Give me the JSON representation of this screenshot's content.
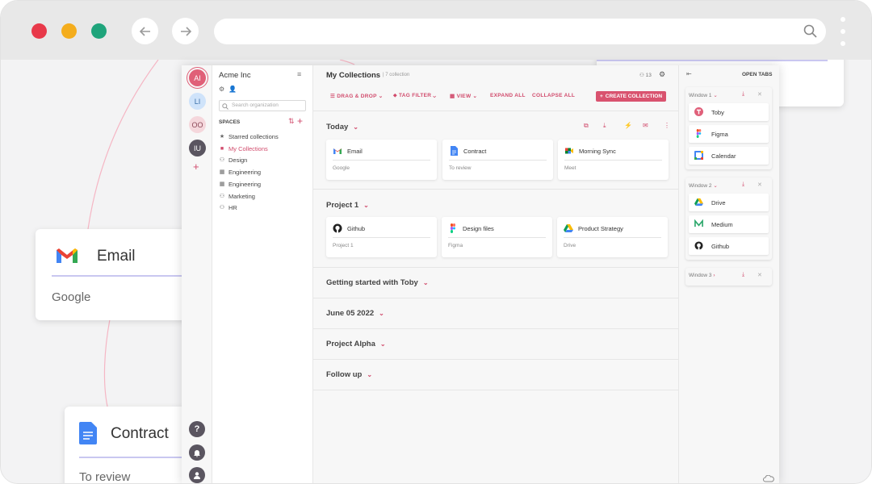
{
  "workspace": {
    "name": "Acme Inc",
    "search_placeholder": "Search organization",
    "spaces_label": "SPACES"
  },
  "avatars": [
    "AI",
    "LI",
    "OO",
    "IU"
  ],
  "sidebar": {
    "items": [
      {
        "label": "Starred collections",
        "icon": "star-icon"
      },
      {
        "label": "My Collections",
        "icon": "lock-icon"
      },
      {
        "label": "Design",
        "icon": "people-icon"
      },
      {
        "label": "Engineering",
        "icon": "building-icon"
      },
      {
        "label": "Engineering",
        "icon": "building-icon"
      },
      {
        "label": "Marketing",
        "icon": "people-icon"
      },
      {
        "label": "HR",
        "icon": "people-icon"
      }
    ]
  },
  "header": {
    "title": "My Collections",
    "count": "7 collection",
    "members": "13"
  },
  "toolbar": {
    "drag_drop": "DRAG & DROP",
    "tag_filter": "TAG FILTER",
    "view": "VIEW",
    "expand_all": "EXPAND ALL",
    "collapse_all": "COLLAPSE ALL",
    "create": "CREATE COLLECTION"
  },
  "collections": [
    {
      "title": "Today",
      "cards": [
        {
          "name": "Email",
          "sub": "Google",
          "icon": "gmail-icon"
        },
        {
          "name": "Contract",
          "sub": "To review",
          "icon": "docs-icon"
        },
        {
          "name": "Morning Sync",
          "sub": "Meet",
          "icon": "meet-icon"
        }
      ]
    },
    {
      "title": "Project 1",
      "cards": [
        {
          "name": "Github",
          "sub": "Project 1",
          "icon": "github-icon"
        },
        {
          "name": "Design files",
          "sub": "Figma",
          "icon": "figma-icon"
        },
        {
          "name": "Product Strategy",
          "sub": "Drive",
          "icon": "drive-icon"
        }
      ]
    },
    {
      "title": "Getting started with Toby"
    },
    {
      "title": "June 05 2022"
    },
    {
      "title": "Project Alpha"
    },
    {
      "title": "Follow up"
    }
  ],
  "open_tabs": {
    "label": "OPEN TABS",
    "windows": [
      {
        "name": "Window 1",
        "tabs": [
          {
            "name": "Toby",
            "icon": "toby-icon"
          },
          {
            "name": "Figma",
            "icon": "figma-icon"
          },
          {
            "name": "Calendar",
            "icon": "calendar-icon"
          }
        ]
      },
      {
        "name": "Window 2",
        "tabs": [
          {
            "name": "Drive",
            "icon": "drive-icon"
          },
          {
            "name": "Medium",
            "icon": "medium-icon"
          },
          {
            "name": "Github",
            "icon": "github-icon"
          }
        ]
      },
      {
        "name": "Window 3",
        "tabs": []
      }
    ]
  },
  "background_cards": [
    {
      "title": "Email",
      "sub": "Google"
    },
    {
      "title": "Contract",
      "sub": "To review"
    }
  ],
  "colors": {
    "accent": "#d14b6c",
    "close": "#e8394a",
    "minimize": "#f4ad1d",
    "maximize": "#1fa47b"
  }
}
